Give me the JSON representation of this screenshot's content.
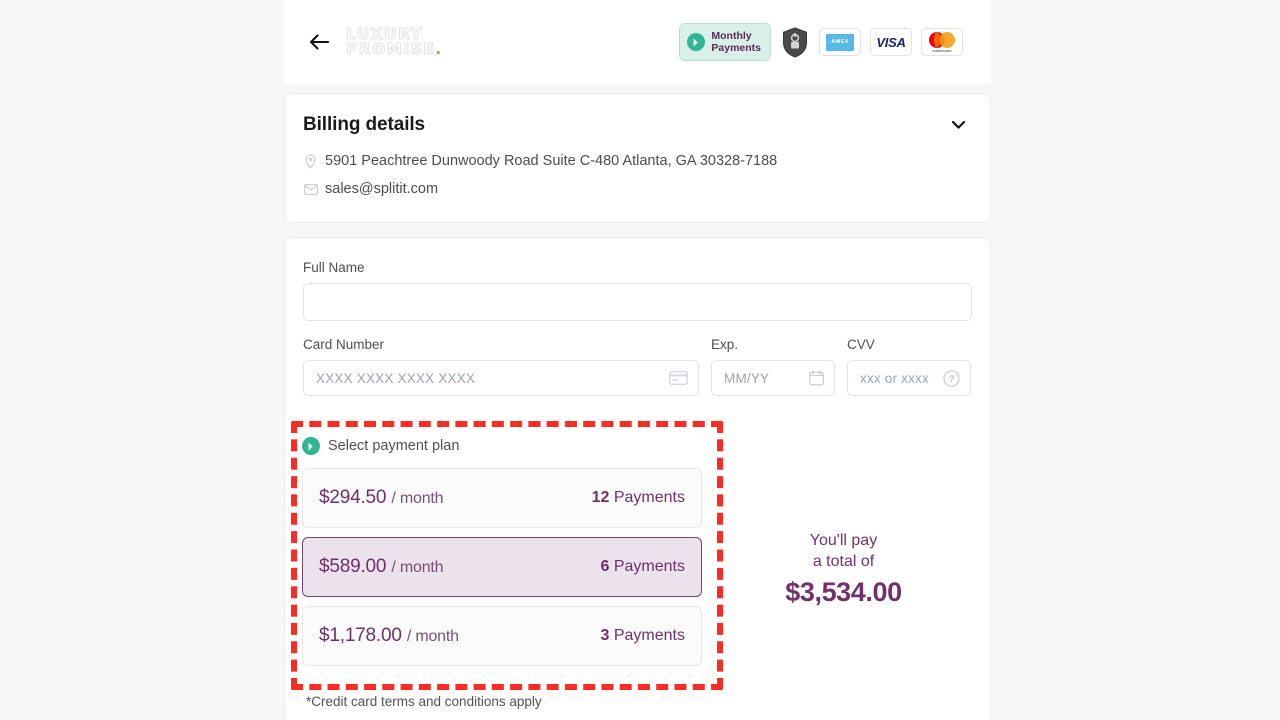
{
  "header": {
    "back_icon": "back-arrow-icon",
    "brand_line1": "LUXURY",
    "brand_line2": "PROMISE",
    "brand_dot": ".",
    "monthly_badge": {
      "line1": "Monthly",
      "line2": "Payments",
      "icon": "splitit-chevron-icon",
      "bg_color": "#d9f0e9",
      "accent_color": "#2fb795"
    },
    "badges": [
      {
        "name": "security-shield-badge",
        "label": ""
      },
      {
        "name": "amex-card-badge",
        "label": "AMEX"
      },
      {
        "name": "visa-card-badge",
        "label": "VISA"
      },
      {
        "name": "mastercard-badge",
        "label": "mastercard"
      }
    ]
  },
  "billing": {
    "title": "Billing details",
    "collapse_icon": "chevron-down-icon",
    "address": "5901 Peachtree Dunwoody Road Suite C-480 Atlanta, GA 30328-7188",
    "email": "sales@splitit.com",
    "address_icon": "location-pin-icon",
    "email_icon": "envelope-icon"
  },
  "form": {
    "full_name": {
      "label": "Full Name",
      "value": "",
      "placeholder": ""
    },
    "card_number": {
      "label": "Card Number",
      "value": "",
      "placeholder": "XXXX XXXX XXXX XXXX",
      "icon": "credit-card-icon"
    },
    "expiry": {
      "label": "Exp.",
      "value": "",
      "placeholder": "MM/YY",
      "icon": "calendar-icon"
    },
    "cvv": {
      "label": "CVV",
      "value": "",
      "placeholder": "xxx or xxxx",
      "icon": "help-question-icon"
    }
  },
  "plan": {
    "heading": "Select payment plan",
    "heading_icon": "splitit-chevron-icon",
    "options": [
      {
        "amount": "$294.50",
        "per": "/ month",
        "count": "12",
        "count_label": "Payments",
        "selected": false
      },
      {
        "amount": "$589.00",
        "per": "/ month",
        "count": "6",
        "count_label": "Payments",
        "selected": true
      },
      {
        "amount": "$1,178.00",
        "per": "/ month",
        "count": "3",
        "count_label": "Payments",
        "selected": false
      }
    ],
    "terms": "*Credit card terms and conditions apply",
    "selected_border_color": "#7b3f77",
    "selected_bg_color": "#ece2ec"
  },
  "summary": {
    "lead_line1": "You'll pay",
    "lead_line2": "a total of",
    "total": "$3,534.00",
    "accent_color": "#73306e"
  },
  "annotation": {
    "highlight_color": "#fb2c24",
    "target": "select-payment-plan-region"
  }
}
